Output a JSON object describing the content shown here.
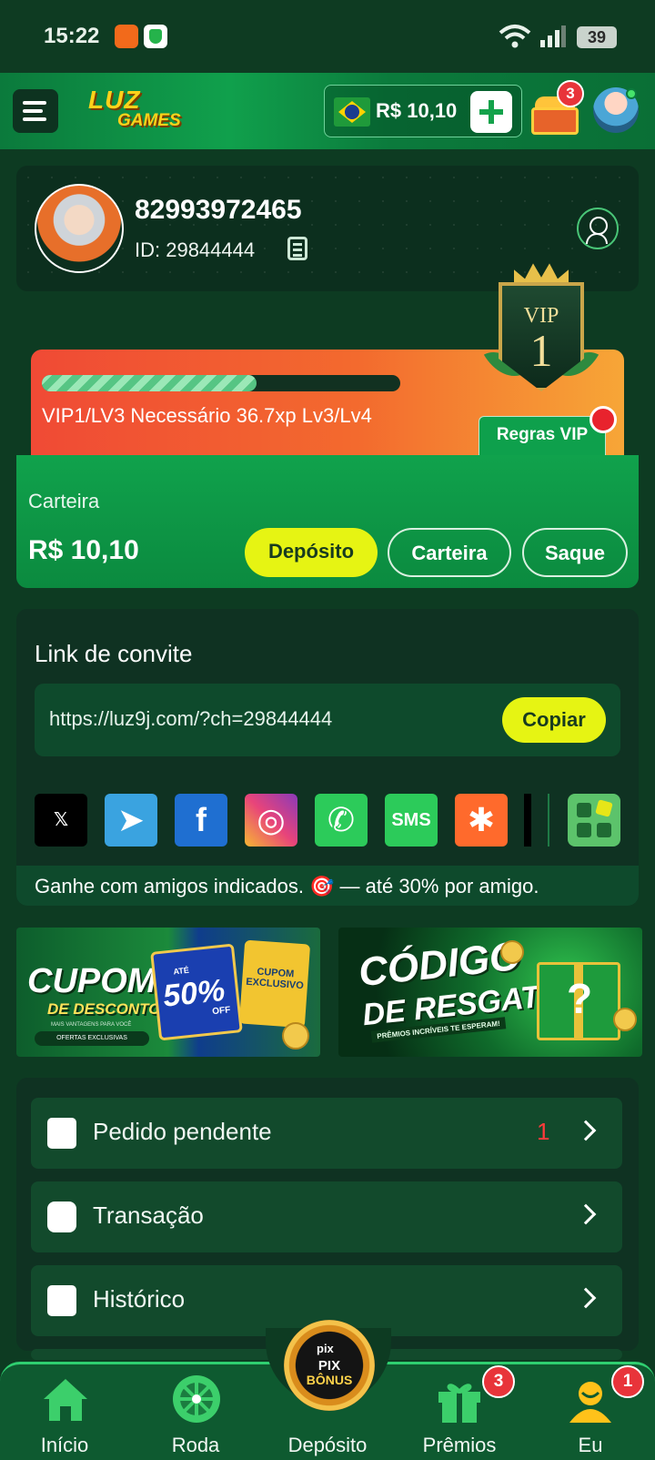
{
  "status_bar": {
    "time": "15:22",
    "battery": "39"
  },
  "header": {
    "logo_line1": "LUZ",
    "logo_line2": "GAMES",
    "balance": "R$ 10,10",
    "chest_badge": "3"
  },
  "profile": {
    "phone": "82993972465",
    "id_text": "ID: 29844444"
  },
  "vip": {
    "progress_fraction": 0.6,
    "status_text": "VIP1/LV3  Necessário 36.7xp Lv3/Lv4",
    "rules_button": "Regras VIP",
    "badge_label": "VIP",
    "badge_level": "1"
  },
  "wallet": {
    "label": "Carteira",
    "amount": "R$ 10,10",
    "deposit_button": "Depósito",
    "wallet_button": "Carteira",
    "withdraw_button": "Saque"
  },
  "invite": {
    "title": "Link de convite",
    "url": "https://luz9j.com/?ch=29844444",
    "copy_button": "Copiar",
    "social": [
      {
        "name": "x-icon",
        "glyph": "𝕏",
        "color": "#000000"
      },
      {
        "name": "telegram-icon",
        "glyph": "➤",
        "color": "#3aa3e0"
      },
      {
        "name": "facebook-icon",
        "glyph": "f",
        "color": "#1f6fd1"
      },
      {
        "name": "instagram-icon",
        "glyph": "◎",
        "color": "#e8447a"
      },
      {
        "name": "whatsapp-icon",
        "glyph": "✆",
        "color": "#2ccb5a"
      },
      {
        "name": "sms-icon",
        "glyph": "SMS",
        "color": "#2ccb5a"
      },
      {
        "name": "kwai-icon",
        "glyph": "✱",
        "color": "#ff6a2c"
      }
    ],
    "note": "Ganhe com amigos indicados. 🎯 — até 30% por amigo."
  },
  "banners": {
    "b1_title1": "CUPOM",
    "b1_title2": "DE DESCONTO",
    "b1_tag": "MAIS VANTAGENS PARA VOCÊ",
    "b1_pill": "OFERTAS EXCLUSIVAS",
    "b1_upto": "ATÉ",
    "b1_pct": "50%",
    "b1_off": "OFF",
    "b1_ticket": "CUPOM EXCLUSIVO",
    "b2_title1": "CÓDIGO",
    "b2_title2": "DE RESGATE",
    "b2_tag": "PRÊMIOS INCRÍVEIS TE ESPERAM!"
  },
  "menu": [
    {
      "label": "Pedido pendente",
      "count": "1"
    },
    {
      "label": "Transação",
      "count": ""
    },
    {
      "label": "Histórico",
      "count": ""
    }
  ],
  "nav": {
    "home": "Início",
    "wheel": "Roda",
    "deposit": "Depósito",
    "prizes": "Prêmios",
    "prizes_badge": "3",
    "me": "Eu",
    "me_badge": "1",
    "center_top": "pix",
    "center_line1": "PIX",
    "center_line2": "BÔNUS"
  },
  "colors": {
    "accent": "#e6f413",
    "primary_green": "#10a24c",
    "background": "#0d3b22",
    "alert_red": "#e8343a"
  }
}
